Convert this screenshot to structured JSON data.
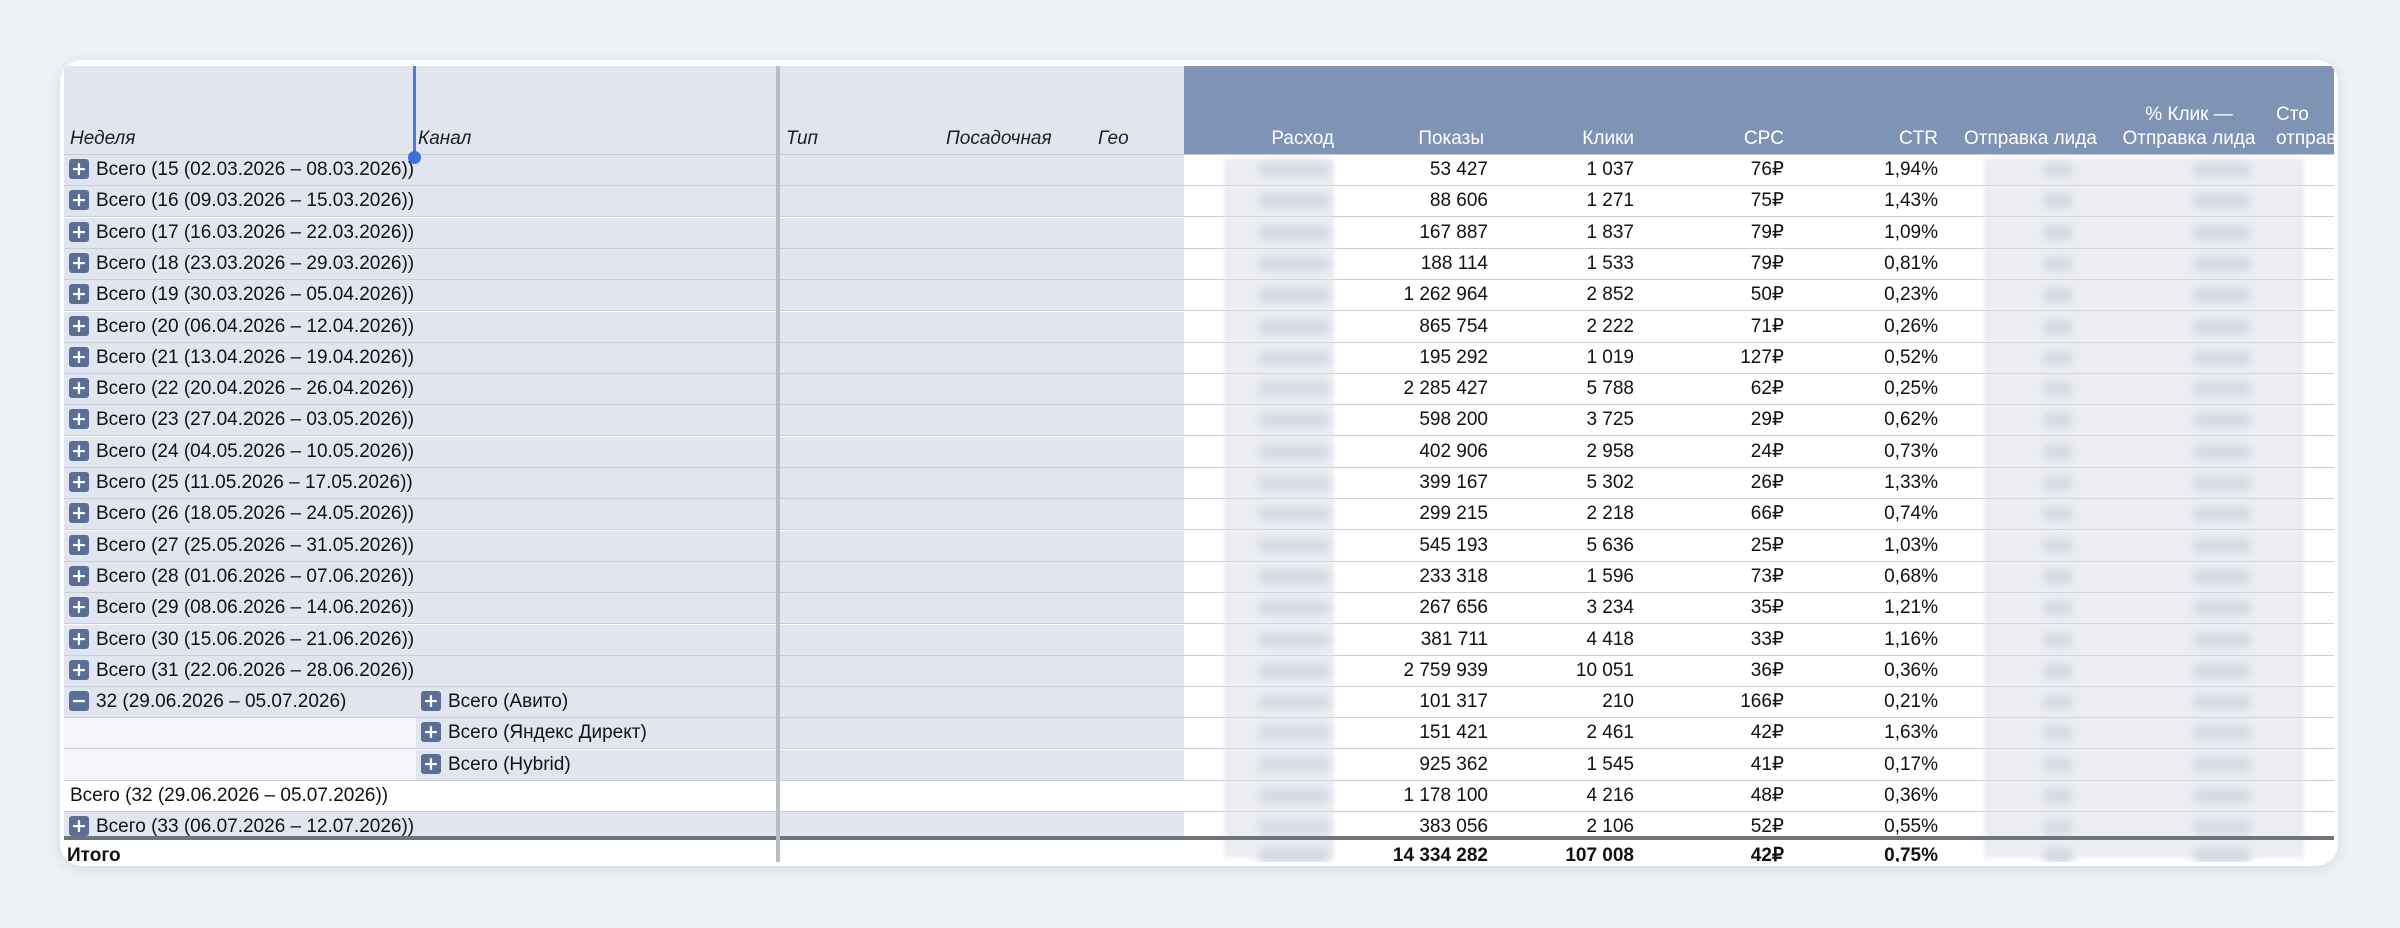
{
  "headers": {
    "left": [
      "Неделя",
      "Канал",
      "Тип",
      "Посадочная",
      "Гео"
    ],
    "metrics": [
      {
        "label": "Расход"
      },
      {
        "label": "Показы"
      },
      {
        "label": "Клики"
      },
      {
        "label": "CPC"
      },
      {
        "label": "CTR"
      },
      {
        "label": "Отправка лида"
      },
      {
        "label_top": "% Клик —",
        "label": "Отправка лида"
      },
      {
        "label_top": "Сто",
        "label": "отправ"
      }
    ]
  },
  "rows": [
    {
      "week": "Всего (15 (02.03.2026 – 08.03.2026))",
      "channel": "",
      "impressions": "53 427",
      "clicks": "1 037",
      "cpc": "76₽",
      "ctr": "1,94%",
      "toggle": "+"
    },
    {
      "week": "Всего (16 (09.03.2026 – 15.03.2026))",
      "channel": "",
      "impressions": "88 606",
      "clicks": "1 271",
      "cpc": "75₽",
      "ctr": "1,43%",
      "toggle": "+"
    },
    {
      "week": "Всего (17 (16.03.2026 – 22.03.2026))",
      "channel": "",
      "impressions": "167 887",
      "clicks": "1 837",
      "cpc": "79₽",
      "ctr": "1,09%",
      "toggle": "+"
    },
    {
      "week": "Всего (18 (23.03.2026 – 29.03.2026))",
      "channel": "",
      "impressions": "188 114",
      "clicks": "1 533",
      "cpc": "79₽",
      "ctr": "0,81%",
      "toggle": "+"
    },
    {
      "week": "Всего (19 (30.03.2026 – 05.04.2026))",
      "channel": "",
      "impressions": "1 262 964",
      "clicks": "2 852",
      "cpc": "50₽",
      "ctr": "0,23%",
      "toggle": "+"
    },
    {
      "week": "Всего (20 (06.04.2026 – 12.04.2026))",
      "channel": "",
      "impressions": "865 754",
      "clicks": "2 222",
      "cpc": "71₽",
      "ctr": "0,26%",
      "toggle": "+"
    },
    {
      "week": "Всего (21 (13.04.2026 – 19.04.2026))",
      "channel": "",
      "impressions": "195 292",
      "clicks": "1 019",
      "cpc": "127₽",
      "ctr": "0,52%",
      "toggle": "+"
    },
    {
      "week": "Всего (22 (20.04.2026 – 26.04.2026))",
      "channel": "",
      "impressions": "2 285 427",
      "clicks": "5 788",
      "cpc": "62₽",
      "ctr": "0,25%",
      "toggle": "+"
    },
    {
      "week": "Всего (23 (27.04.2026 – 03.05.2026))",
      "channel": "",
      "impressions": "598 200",
      "clicks": "3 725",
      "cpc": "29₽",
      "ctr": "0,62%",
      "toggle": "+"
    },
    {
      "week": "Всего (24 (04.05.2026 – 10.05.2026))",
      "channel": "",
      "impressions": "402 906",
      "clicks": "2 958",
      "cpc": "24₽",
      "ctr": "0,73%",
      "toggle": "+"
    },
    {
      "week": "Всего (25 (11.05.2026 – 17.05.2026))",
      "channel": "",
      "impressions": "399 167",
      "clicks": "5 302",
      "cpc": "26₽",
      "ctr": "1,33%",
      "toggle": "+"
    },
    {
      "week": "Всего (26 (18.05.2026 – 24.05.2026))",
      "channel": "",
      "impressions": "299 215",
      "clicks": "2 218",
      "cpc": "66₽",
      "ctr": "0,74%",
      "toggle": "+"
    },
    {
      "week": "Всего (27 (25.05.2026 – 31.05.2026))",
      "channel": "",
      "impressions": "545 193",
      "clicks": "5 636",
      "cpc": "25₽",
      "ctr": "1,03%",
      "toggle": "+"
    },
    {
      "week": "Всего (28 (01.06.2026 – 07.06.2026))",
      "channel": "",
      "impressions": "233 318",
      "clicks": "1 596",
      "cpc": "73₽",
      "ctr": "0,68%",
      "toggle": "+"
    },
    {
      "week": "Всего (29 (08.06.2026 – 14.06.2026))",
      "channel": "",
      "impressions": "267 656",
      "clicks": "3 234",
      "cpc": "35₽",
      "ctr": "1,21%",
      "toggle": "+"
    },
    {
      "week": "Всего (30 (15.06.2026 – 21.06.2026))",
      "channel": "",
      "impressions": "381 711",
      "clicks": "4 418",
      "cpc": "33₽",
      "ctr": "1,16%",
      "toggle": "+"
    },
    {
      "week": "Всего (31 (22.06.2026 – 28.06.2026))",
      "channel": "",
      "impressions": "2 759 939",
      "clicks": "10 051",
      "cpc": "36₽",
      "ctr": "0,36%",
      "toggle": "+"
    },
    {
      "week": "32 (29.06.2026 – 05.07.2026)",
      "channel": "Всего (Авито)",
      "impressions": "101 317",
      "clicks": "210",
      "cpc": "166₽",
      "ctr": "0,21%",
      "toggle": "−",
      "channel_toggle": "+"
    },
    {
      "week": "",
      "channel": "Всего (Яндекс Директ)",
      "impressions": "151 421",
      "clicks": "2 461",
      "cpc": "42₽",
      "ctr": "1,63%",
      "toggle": "",
      "channel_toggle": "+"
    },
    {
      "week": "",
      "channel": "Всего (Hybrid)",
      "impressions": "925 362",
      "clicks": "1 545",
      "cpc": "41₽",
      "ctr": "0,17%",
      "toggle": "",
      "channel_toggle": "+"
    },
    {
      "week": "Всего (32 (29.06.2026 – 05.07.2026))",
      "channel": "",
      "impressions": "1 178 100",
      "clicks": "4 216",
      "cpc": "48₽",
      "ctr": "0,36%",
      "toggle": ""
    },
    {
      "week": "Всего (33 (06.07.2026 – 12.07.2026))",
      "channel": "",
      "impressions": "383 056",
      "clicks": "2 106",
      "cpc": "52₽",
      "ctr": "0,55%",
      "toggle": "+"
    }
  ],
  "total": {
    "label": "Итого",
    "impressions": "14 334 282",
    "clicks": "107 008",
    "cpc": "42₽",
    "ctr": "0,75%"
  },
  "colors": {
    "header_metric_bg": "#7f94b5",
    "header_left_bg": "#e1e5ef",
    "toggle_bg": "#5b6f96",
    "selection": "#3d6fe0"
  }
}
